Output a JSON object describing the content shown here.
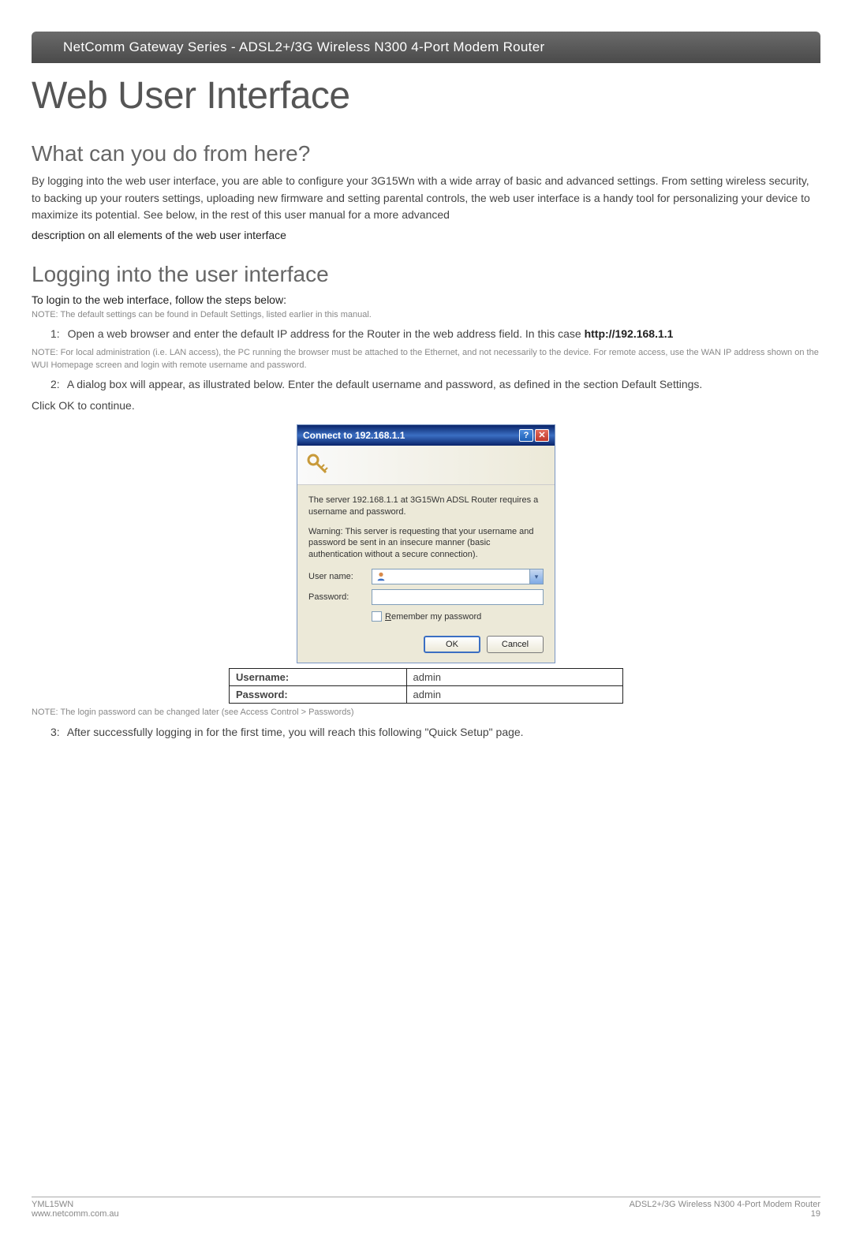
{
  "header": {
    "bar": "NetComm Gateway Series - ADSL2+/3G Wireless N300 4-Port Modem Router"
  },
  "title": "Web User Interface",
  "section1": {
    "heading": "What can you do from here?",
    "para": "By logging into the web user interface, you are able to configure your 3G15Wn with a wide array of basic and advanced settings. From setting wireless security, to backing up your routers settings, uploading new firmware and setting parental controls, the web user interface is a handy tool for personalizing your device to maximize its potential. See below, in the rest of this user manual for a more advanced",
    "para_bold": "description on all elements of the web user interface"
  },
  "section2": {
    "heading": "Logging into the user interface",
    "instruction": "To login to the web interface, follow the steps below:",
    "note1": "NOTE: The default settings can be found in Default Settings, listed earlier in this manual.",
    "step1_pre": "1:",
    "step1_text": "Open a web browser and enter the default IP address for the Router in the web address field. In this case ",
    "step1_url": "http://192.168.1.1",
    "note2_prefix": "NOTE: ",
    "note2": "For local administration (i.e. LAN access), the PC running the browser must be attached to the Ethernet, and not necessarily to the device. For remote access, use the WAN IP address shown on the WUI Homepage screen and login with remote username and password.",
    "step2_pre": "2:",
    "step2_text": "A dialog box will appear, as illustrated below. Enter the default username and password, as defined in the section Default Settings.",
    "click_ok": "Click OK to continue.",
    "note3": "NOTE: The login password can be changed later (see Access Control > Passwords)",
    "step3_pre": "3:",
    "step3_text": "After successfully logging in for the first time, you will reach this following \"Quick Setup\" page."
  },
  "dialog": {
    "title": "Connect to 192.168.1.1",
    "body1": "The server 192.168.1.1 at 3G15Wn ADSL Router requires a username and password.",
    "body2": "Warning: This server is requesting that your username and password be sent in an insecure manner (basic authentication without a secure connection).",
    "username_label": "User name:",
    "password_label": "Password:",
    "remember_u": "R",
    "remember_rest": "emember my password",
    "ok_label": "OK",
    "cancel_label": "Cancel"
  },
  "credentials": {
    "user_label": "Username:",
    "user_value": "admin",
    "pass_label": "Password:",
    "pass_value": "admin"
  },
  "footer": {
    "left1": "YML15WN",
    "left2": "www.netcomm.com.au",
    "right1": "ADSL2+/3G Wireless N300 4-Port Modem Router",
    "right2": "19"
  }
}
